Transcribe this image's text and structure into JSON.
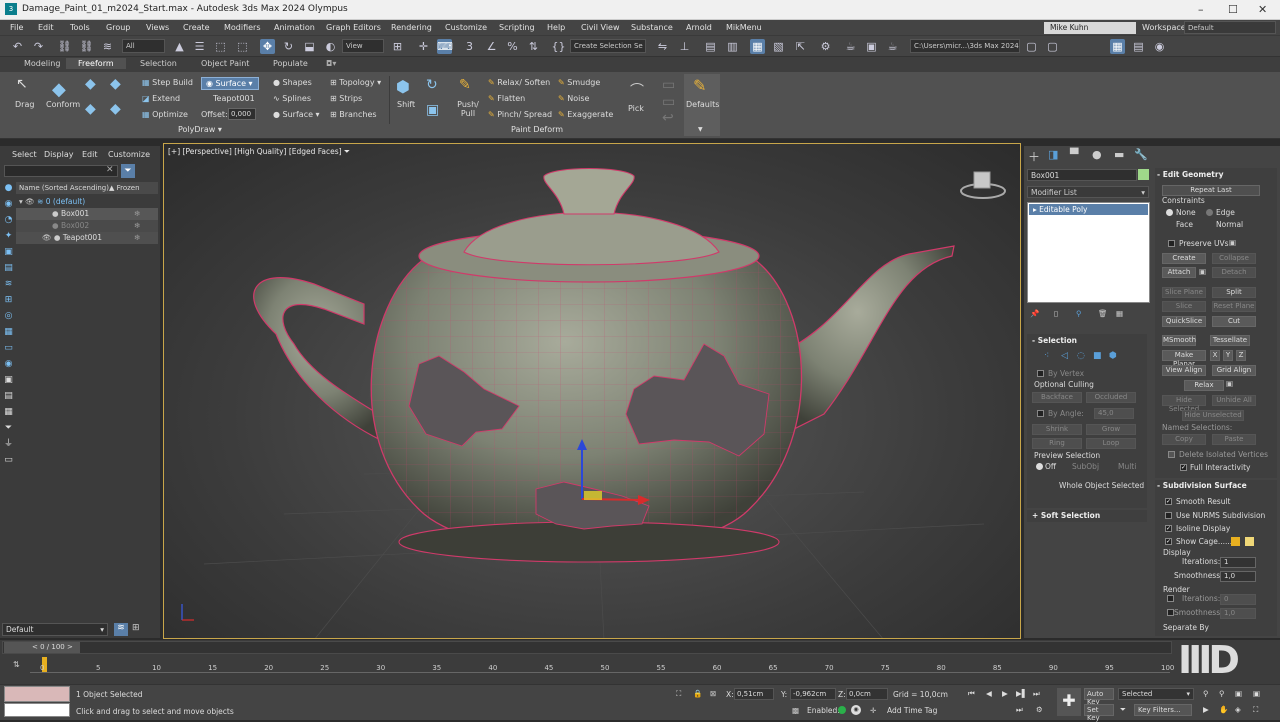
{
  "window": {
    "title": "Damage_Paint_01_m2024_Start.max - Autodesk 3ds Max 2024 Olympus",
    "user": "Mike Kuhn",
    "workspace_label": "Workspaces:",
    "workspace": "Default"
  },
  "menu": [
    "File",
    "Edit",
    "Tools",
    "Group",
    "Views",
    "Create",
    "Modifiers",
    "Animation",
    "Graph Editors",
    "Rendering",
    "Customize",
    "Scripting",
    "Help",
    "Civil View",
    "Substance",
    "Arnold",
    "MikMenu"
  ],
  "toolbar": {
    "filter": "All",
    "view": "View",
    "selection_set": "Create Selection Se",
    "path": "C:\\Users\\micr...\\3ds Max 2024"
  },
  "ribbon_tabs": [
    "Modeling",
    "Freeform",
    "Selection",
    "Object Paint",
    "Populate"
  ],
  "ribbon": {
    "polydraw": {
      "drag": "Drag",
      "conform": "Conform",
      "step_build": "Step Build",
      "extend": "Extend",
      "optimize": "Optimize",
      "surface_btn": "Surface",
      "target": "Teapot001",
      "offset_label": "Offset:",
      "offset": "0,000",
      "shapes": "Shapes",
      "splines": "Splines",
      "surface": "Surface",
      "topology": "Topology",
      "strips": "Strips",
      "branches": "Branches",
      "group": "PolyDraw"
    },
    "paintdeform": {
      "shift": "Shift",
      "push_pull": "Push/ Pull",
      "relax_soften": "Relax/ Soften",
      "flatten": "Flatten",
      "pinch_spread": "Pinch/ Spread",
      "smudge": "Smudge",
      "noise": "Noise",
      "exaggerate": "Exaggerate",
      "pick": "Pick",
      "defaults": "Defaults",
      "group": "Paint Deform"
    }
  },
  "scene_explorer": {
    "tabs": [
      "Select",
      "Display",
      "Edit",
      "Customize"
    ],
    "col_name": "Name (Sorted Ascending)",
    "col_frozen": "▲ Frozen",
    "rows": [
      "0 (default)",
      "Box001",
      "Box002",
      "Teapot001"
    ],
    "layer": "Default"
  },
  "viewport": {
    "label": "[+] [Perspective] [High Quality] [Edged Faces]"
  },
  "command_panel": {
    "object_name": "Box001",
    "modifier_list": "Modifier List",
    "stack_item": "Editable Poly",
    "selection": {
      "title": "Selection",
      "by_vertex": "By Vertex",
      "optional_culling": "Optional Culling",
      "backface": "Backface",
      "occluded": "Occluded",
      "by_angle": "By Angle:",
      "angle": "45,0",
      "shrink": "Shrink",
      "grow": "Grow",
      "ring": "Ring",
      "loop": "Loop",
      "preview_selection": "Preview Selection",
      "off": "Off",
      "subobj": "SubObj",
      "multi": "Multi",
      "whole_object": "Whole Object Selected"
    },
    "soft_selection": "Soft Selection",
    "edit_geometry": {
      "title": "Edit Geometry",
      "repeat_last": "Repeat Last",
      "constraints": "Constraints",
      "none": "None",
      "edge": "Edge",
      "face": "Face",
      "normal": "Normal",
      "preserve_uvs": "Preserve UVs",
      "create": "Create",
      "collapse": "Collapse",
      "attach": "Attach",
      "detach": "Detach",
      "slice_plane": "Slice Plane",
      "split": "Split",
      "slice": "Slice",
      "reset_plane": "Reset Plane",
      "quickslice": "QuickSlice",
      "cut": "Cut",
      "msmooth": "MSmooth",
      "tessellate": "Tessellate",
      "make_planar": "Make Planar",
      "x": "X",
      "y": "Y",
      "z": "Z",
      "view_align": "View Align",
      "grid_align": "Grid Align",
      "relax": "Relax",
      "hide_selected": "Hide Selected",
      "unhide_all": "Unhide All",
      "hide_unselected": "Hide Unselected",
      "named_selections": "Named Selections:",
      "copy": "Copy",
      "paste": "Paste",
      "delete_isolated": "Delete Isolated Vertices",
      "full_interactivity": "Full Interactivity"
    },
    "subdivision": {
      "title": "Subdivision Surface",
      "smooth_result": "Smooth Result",
      "use_nurms": "Use NURMS Subdivision",
      "isoline": "Isoline Display",
      "show_cage": "Show Cage......",
      "display": "Display",
      "iterations_label": "Iterations:",
      "iterations": "1",
      "smoothness_label": "Smoothness:",
      "smoothness": "1,0",
      "render": "Render",
      "r_iterations": "0",
      "r_smoothness": "1,0",
      "separate_by": "Separate By"
    }
  },
  "timeline": {
    "frame": "0 / 100",
    "ticks": [
      "0",
      "5",
      "10",
      "15",
      "20",
      "25",
      "30",
      "35",
      "40",
      "45",
      "50",
      "55",
      "60",
      "65",
      "70",
      "75",
      "80",
      "85",
      "90",
      "95",
      "100"
    ]
  },
  "status": {
    "objects": "1 Object Selected",
    "prompt": "Click and drag to select and move objects",
    "x": "0,51cm",
    "y": "-0,962cm",
    "z": "0,0cm",
    "grid": "Grid = 10,0cm",
    "enabled": "Enabled:",
    "add_time_tag": "Add Time Tag",
    "auto_key": "Auto Key",
    "selected": "Selected",
    "set_key": "Set Key",
    "key_filters": "Key Filters..."
  },
  "colors": {
    "accent": "#5a7fa8",
    "viewport_border": "#c8a64a",
    "wire": "#d03a6a"
  }
}
